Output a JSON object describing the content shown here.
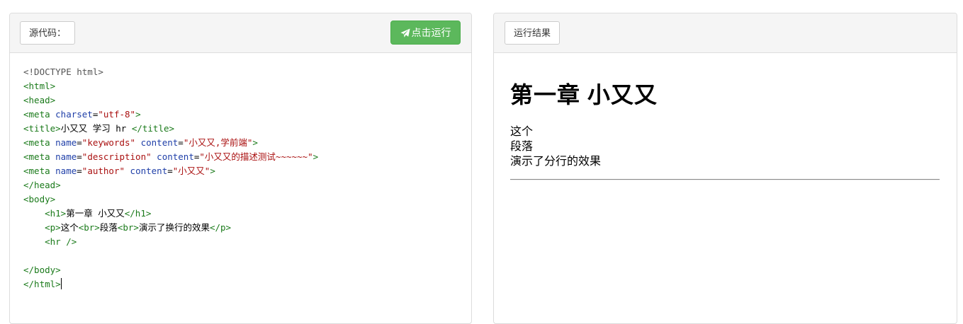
{
  "left_panel": {
    "source_label": "源代码：",
    "run_button_label": "点击运行",
    "run_icon": "paper-plane-icon"
  },
  "code_lines": [
    [
      {
        "c": "d",
        "t": "<!DOCTYPE html>"
      }
    ],
    [
      {
        "c": "g",
        "t": "<html>"
      }
    ],
    [
      {
        "c": "g",
        "t": "<head>"
      }
    ],
    [
      {
        "c": "g",
        "t": "<meta "
      },
      {
        "c": "b",
        "t": "charset"
      },
      {
        "c": "",
        "t": "="
      },
      {
        "c": "r",
        "t": "\"utf-8\""
      },
      {
        "c": "g",
        "t": ">"
      }
    ],
    [
      {
        "c": "g",
        "t": "<title>"
      },
      {
        "c": "",
        "t": "小又又 学习 hr "
      },
      {
        "c": "g",
        "t": "</title>"
      }
    ],
    [
      {
        "c": "g",
        "t": "<meta "
      },
      {
        "c": "b",
        "t": "name"
      },
      {
        "c": "",
        "t": "="
      },
      {
        "c": "r",
        "t": "\"keywords\""
      },
      {
        "c": "",
        "t": " "
      },
      {
        "c": "b",
        "t": "content"
      },
      {
        "c": "",
        "t": "="
      },
      {
        "c": "r",
        "t": "\"小又又,学前端\""
      },
      {
        "c": "g",
        "t": ">"
      }
    ],
    [
      {
        "c": "g",
        "t": "<meta "
      },
      {
        "c": "b",
        "t": "name"
      },
      {
        "c": "",
        "t": "="
      },
      {
        "c": "r",
        "t": "\"description\""
      },
      {
        "c": "",
        "t": " "
      },
      {
        "c": "b",
        "t": "content"
      },
      {
        "c": "",
        "t": "="
      },
      {
        "c": "r",
        "t": "\"小又又的描述测试~~~~~~\""
      },
      {
        "c": "g",
        "t": ">"
      }
    ],
    [
      {
        "c": "g",
        "t": "<meta "
      },
      {
        "c": "b",
        "t": "name"
      },
      {
        "c": "",
        "t": "="
      },
      {
        "c": "r",
        "t": "\"author\""
      },
      {
        "c": "",
        "t": " "
      },
      {
        "c": "b",
        "t": "content"
      },
      {
        "c": "",
        "t": "="
      },
      {
        "c": "r",
        "t": "\"小又又\""
      },
      {
        "c": "g",
        "t": ">"
      }
    ],
    [
      {
        "c": "g",
        "t": "</head>"
      }
    ],
    [
      {
        "c": "g",
        "t": "<body>"
      }
    ],
    [
      {
        "c": "",
        "t": "    "
      },
      {
        "c": "g",
        "t": "<h1>"
      },
      {
        "c": "",
        "t": "第一章 小又又"
      },
      {
        "c": "g",
        "t": "</h1>"
      }
    ],
    [
      {
        "c": "",
        "t": "    "
      },
      {
        "c": "g",
        "t": "<p>"
      },
      {
        "c": "",
        "t": "这个"
      },
      {
        "c": "g",
        "t": "<br>"
      },
      {
        "c": "",
        "t": "段落"
      },
      {
        "c": "g",
        "t": "<br>"
      },
      {
        "c": "",
        "t": "演示了换行的效果"
      },
      {
        "c": "g",
        "t": "</p>"
      }
    ],
    [
      {
        "c": "",
        "t": "    "
      },
      {
        "c": "g",
        "t": "<hr />"
      }
    ],
    [],
    [
      {
        "c": "g",
        "t": "</body>"
      }
    ],
    [
      {
        "c": "g",
        "t": "</html>"
      }
    ]
  ],
  "right_panel": {
    "result_label": "运行结果",
    "heading": "第一章 小又又",
    "paragraph_lines": [
      "这个",
      "段落",
      "演示了分行的效果"
    ]
  },
  "colors": {
    "run_button": "#5cb85c",
    "code_tag": "#1a7a1a",
    "code_attr": "#1f3fa8",
    "code_string": "#a11"
  }
}
